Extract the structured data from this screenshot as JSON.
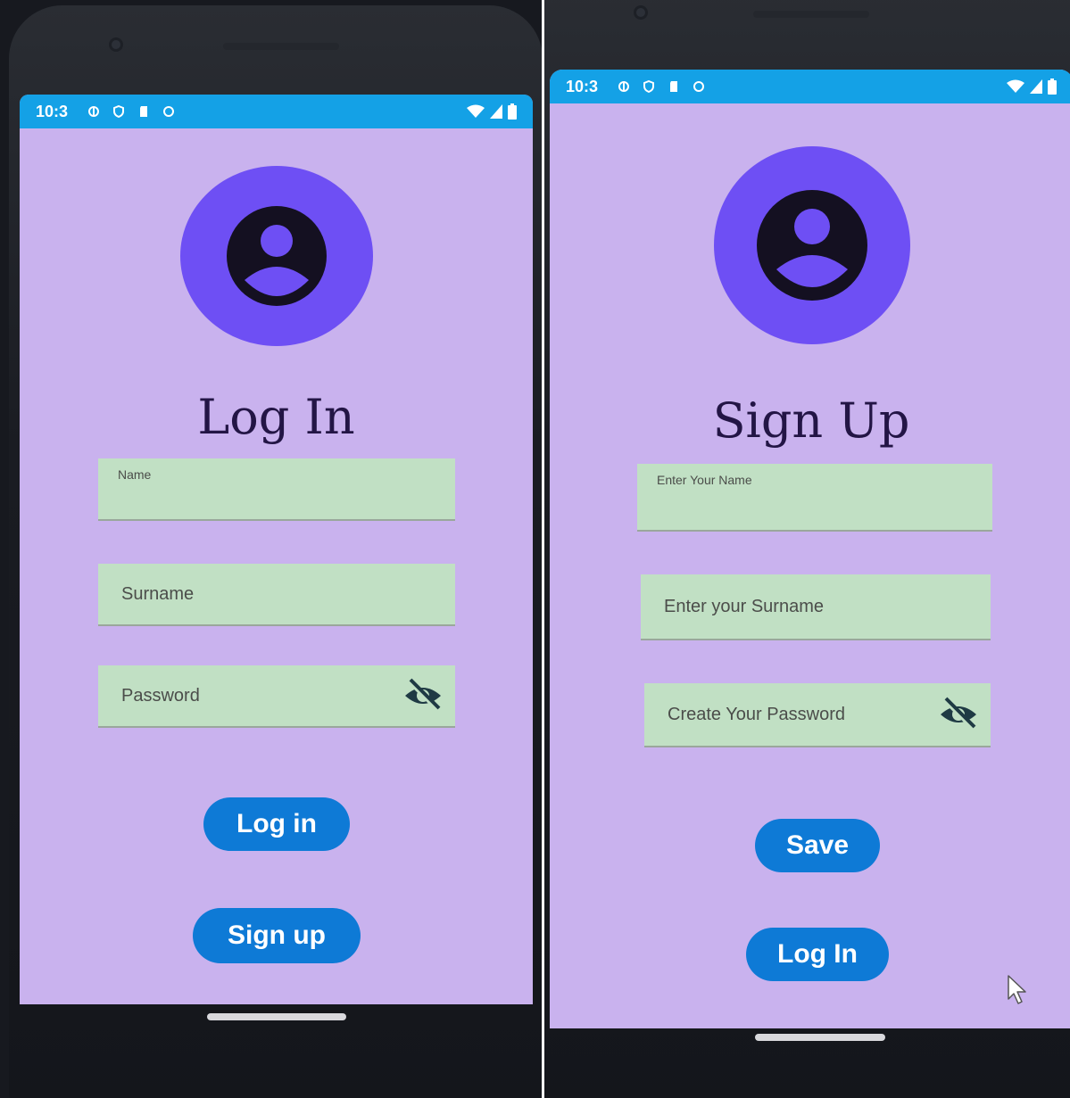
{
  "status_bar": {
    "time": "10:3"
  },
  "login_screen": {
    "title": "Log In",
    "fields": {
      "name": {
        "placeholder": "Name"
      },
      "surname": {
        "placeholder": "Surname"
      },
      "password": {
        "placeholder": "Password"
      }
    },
    "buttons": {
      "login": "Log in",
      "signup": "Sign up"
    }
  },
  "signup_screen": {
    "title": "Sign Up",
    "fields": {
      "name": {
        "placeholder": "Enter Your Name"
      },
      "surname": {
        "placeholder": "Enter your Surname"
      },
      "password": {
        "placeholder": "Create Your Password"
      }
    },
    "buttons": {
      "save": "Save",
      "login": "Log In"
    }
  },
  "icons": {
    "avatar": "account-circle-icon",
    "password_toggle": "eye-off-icon",
    "wifi": "wifi-icon",
    "signal": "signal-icon",
    "battery": "battery-icon"
  },
  "colors": {
    "status_bar": "#14a1e6",
    "screen_background": "#c9b2ee",
    "avatar_circle": "#6e4ff4",
    "field_background": "#c1e0c4",
    "button": "#0e7ad6",
    "heading_text": "#231545"
  }
}
